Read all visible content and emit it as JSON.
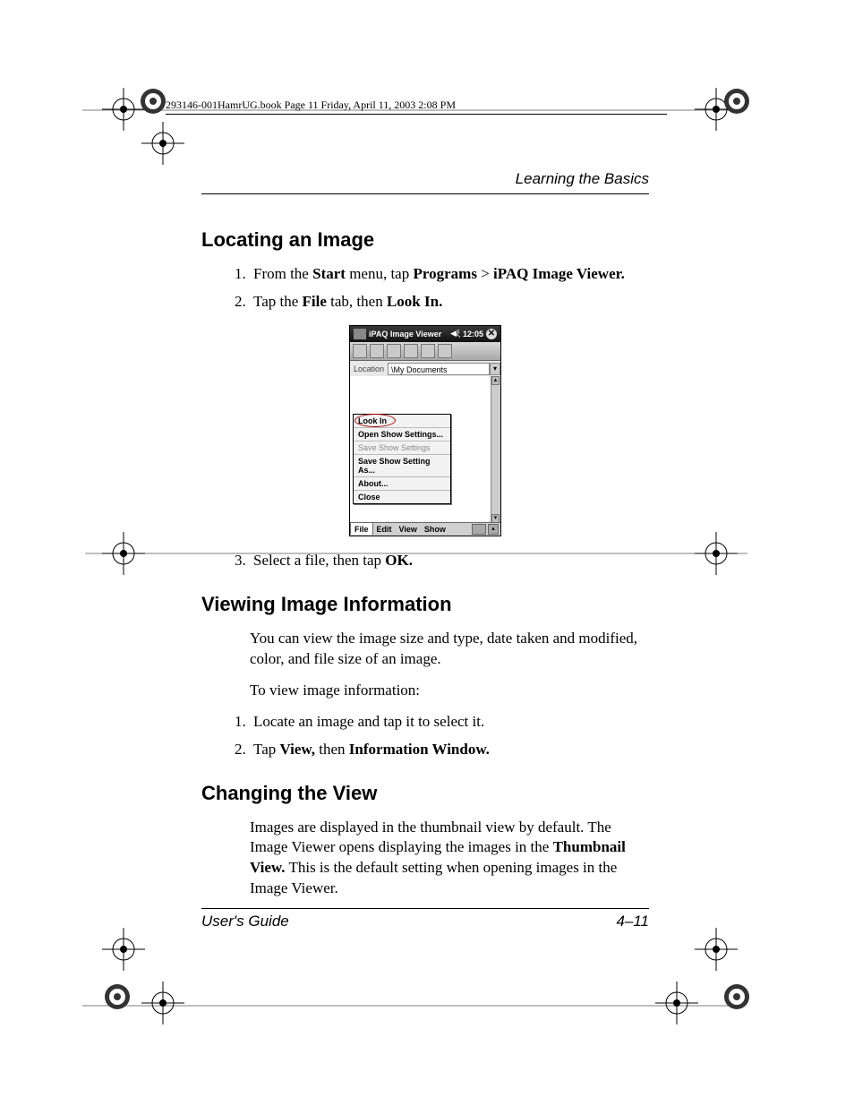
{
  "print_header": "293146-001HamrUG.book  Page 11  Friday, April 11, 2003  2:08 PM",
  "running_head": "Learning the Basics",
  "section1": {
    "title": "Locating an Image",
    "step1_pre": "From the ",
    "step1_b1": "Start",
    "step1_mid": " menu, tap ",
    "step1_b2": "Programs",
    "step1_gt": " > ",
    "step1_b3": "iPAQ Image Viewer.",
    "step2_pre": "Tap the ",
    "step2_b1": "File",
    "step2_mid": " tab, then ",
    "step2_b2": "Look In.",
    "step3_pre": "Select a file, then tap ",
    "step3_b1": "OK."
  },
  "screenshot": {
    "title": "iPAQ Image Viewer",
    "time": "12:05",
    "location_label": "Location",
    "location_value": "\\My Documents",
    "menu": {
      "look_in": "Look In",
      "open": "Open Show Settings...",
      "save": "Save Show Settings",
      "save_as": "Save Show Setting As...",
      "about": "About...",
      "close": "Close"
    },
    "tabs": {
      "file": "File",
      "edit": "Edit",
      "view": "View",
      "show": "Show"
    }
  },
  "section2": {
    "title": "Viewing Image Information",
    "para1": "You can view the image size and type, date taken and modified, color, and file size of an image.",
    "para2": "To view image information:",
    "step1": "Locate an image and tap it to select it.",
    "step2_pre": "Tap ",
    "step2_b1": "View,",
    "step2_mid": " then ",
    "step2_b2": "Information Window."
  },
  "section3": {
    "title": "Changing the View",
    "para_a": "Images are displayed in the thumbnail view by default. The Image Viewer opens displaying the images in the ",
    "para_b_bold": "Thumbnail View.",
    "para_c": " This is the default setting when opening images in the Image Viewer."
  },
  "footer": {
    "left": "User's Guide",
    "right": "4–11"
  }
}
